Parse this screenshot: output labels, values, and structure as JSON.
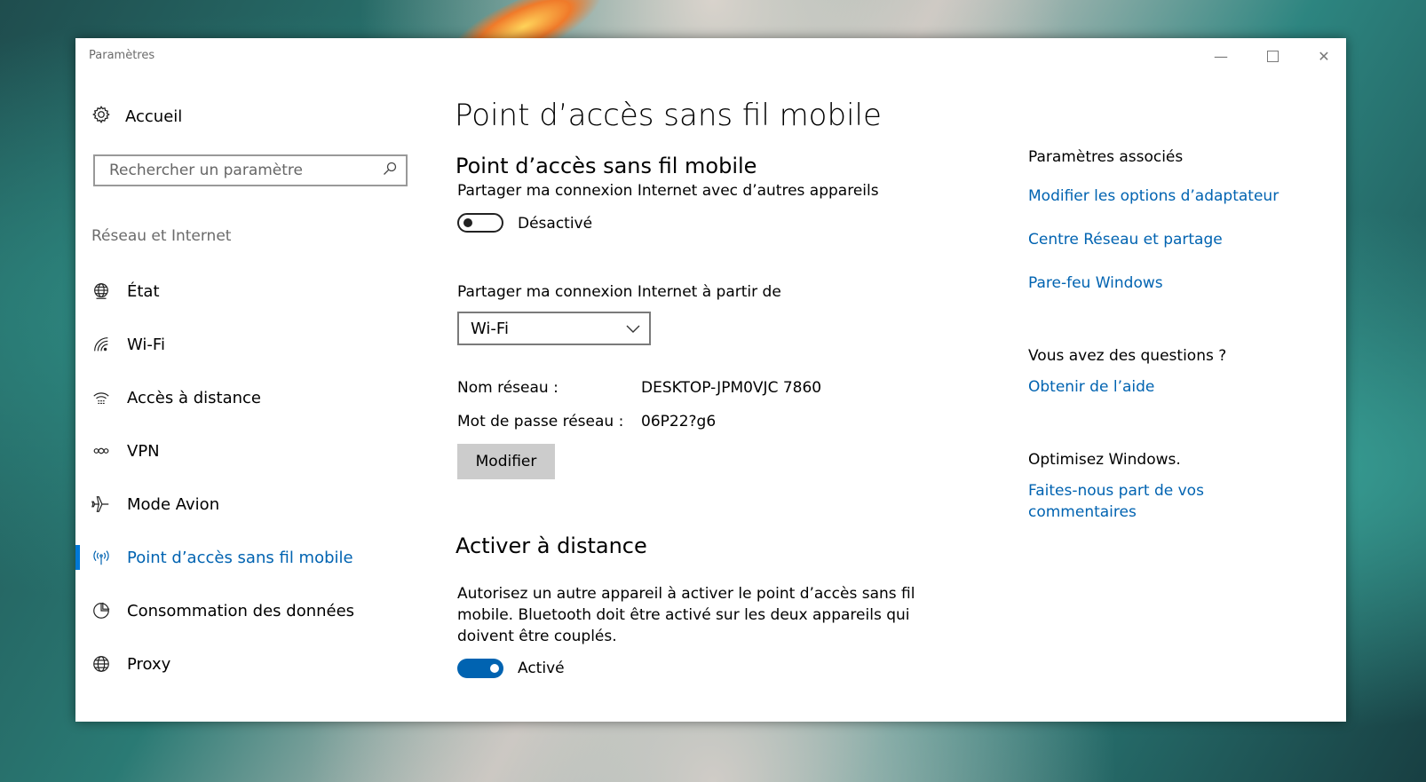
{
  "window": {
    "title": "Paramètres"
  },
  "sidebar": {
    "home_label": "Accueil",
    "search_placeholder": "Rechercher un paramètre",
    "section_label": "Réseau et Internet",
    "items": [
      {
        "label": "État",
        "icon": "globe-network-icon"
      },
      {
        "label": "Wi-Fi",
        "icon": "wifi-icon"
      },
      {
        "label": "Accès à distance",
        "icon": "dialup-icon"
      },
      {
        "label": "VPN",
        "icon": "vpn-icon"
      },
      {
        "label": "Mode Avion",
        "icon": "airplane-icon"
      },
      {
        "label": "Point d’accès sans fil mobile",
        "icon": "hotspot-icon",
        "active": true
      },
      {
        "label": "Consommation des données",
        "icon": "pie-chart-icon"
      },
      {
        "label": "Proxy",
        "icon": "globe-icon"
      }
    ]
  },
  "main": {
    "page_title": "Point d’accès sans fil mobile",
    "hotspot": {
      "heading": "Point d’accès sans fil mobile",
      "share_label": "Partager ma connexion Internet avec d’autres appareils",
      "toggle_state": "Désactivé",
      "share_from_label": "Partager ma connexion Internet à partir de",
      "share_from_value": "Wi-Fi",
      "network_name_label": "Nom réseau :",
      "network_name_value": "DESKTOP-JPM0VJC 7860",
      "password_label": "Mot de passe réseau :",
      "password_value": "06P22?g6",
      "edit_button": "Modifier"
    },
    "remote": {
      "heading": "Activer à distance",
      "description": "Autorisez un autre appareil à activer le point d’accès sans fil mobile. Bluetooth doit être activé sur les deux appareils qui doivent être couplés.",
      "toggle_state": "Activé"
    }
  },
  "related": {
    "heading": "Paramètres associés",
    "links": [
      "Modifier les options d’adaptateur",
      "Centre Réseau et partage",
      "Pare-feu Windows"
    ],
    "questions_heading": "Vous avez des questions ?",
    "help_link": "Obtenir de l’aide",
    "improve_heading": "Optimisez Windows.",
    "feedback_link": "Faites-nous part de vos commentaires"
  },
  "colors": {
    "accent": "#0063b1",
    "toggle_on": "#0063b1"
  }
}
